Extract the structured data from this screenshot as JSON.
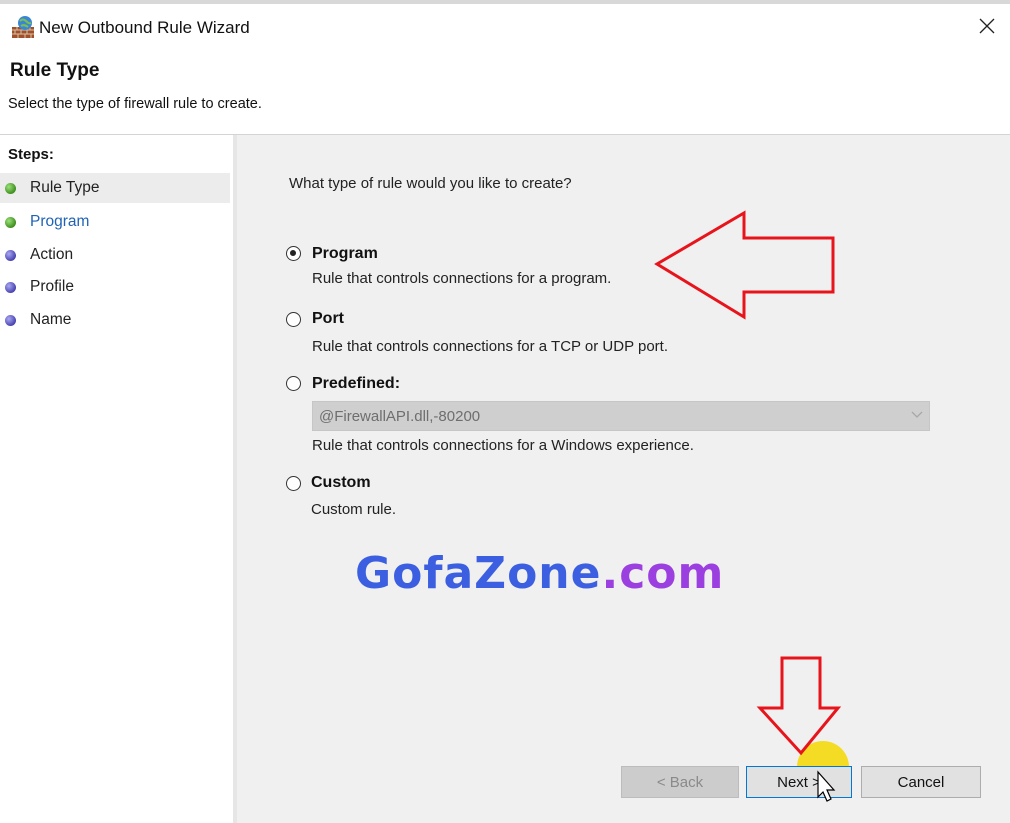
{
  "window": {
    "title": "New Outbound Rule Wizard",
    "app_icon": "firewall-wizard-icon",
    "close_icon": "close-icon"
  },
  "header": {
    "title": "Rule Type",
    "subtitle": "Select the type of firewall rule to create."
  },
  "sidebar": {
    "heading": "Steps:",
    "items": [
      {
        "label": "Rule Type",
        "state": "current",
        "dot_color": "#3e8f1f"
      },
      {
        "label": "Program",
        "state": "link",
        "dot_color": "#3e8f1f"
      },
      {
        "label": "Action",
        "state": "pending",
        "dot_color": "#4844b0"
      },
      {
        "label": "Profile",
        "state": "pending",
        "dot_color": "#4844b0"
      },
      {
        "label": "Name",
        "state": "pending",
        "dot_color": "#4844b0"
      }
    ]
  },
  "main": {
    "question": "What type of rule would you like to create?",
    "options": [
      {
        "label": "Program",
        "description": "Rule that controls connections for a program.",
        "selected": true
      },
      {
        "label": "Port",
        "description": "Rule that controls connections for a TCP or UDP port.",
        "selected": false
      },
      {
        "label": "Predefined:",
        "description": "Rule that controls connections for a Windows experience.",
        "selected": false,
        "dropdown_value": "@FirewallAPI.dll,-80200",
        "dropdown_enabled": false
      },
      {
        "label": "Custom",
        "description": "Custom rule.",
        "selected": false
      }
    ]
  },
  "buttons": {
    "back": "< Back",
    "next": "Next >",
    "cancel": "Cancel",
    "back_enabled": false
  },
  "watermark": {
    "main": "GofaZone",
    "tld": ".com"
  },
  "annotations": {
    "arrow_color": "#e8141b",
    "highlight_color": "#f5d700"
  }
}
